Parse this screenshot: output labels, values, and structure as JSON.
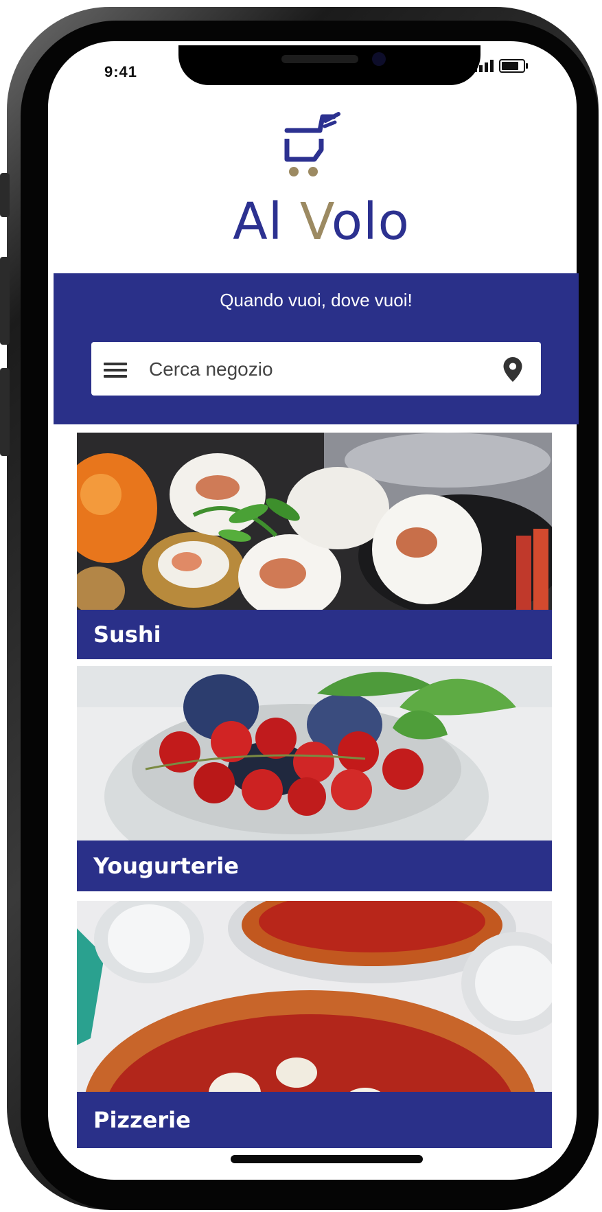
{
  "status_bar": {
    "time": "9:41"
  },
  "app": {
    "name_part1": "Al ",
    "name_v": "V",
    "name_part2": "olo"
  },
  "banner": {
    "tagline": "Quando vuoi, dove vuoi!"
  },
  "search": {
    "placeholder": "Cerca negozio"
  },
  "categories": [
    {
      "label": "Sushi"
    },
    {
      "label": "Yougurterie"
    },
    {
      "label": "Pizzerie"
    }
  ],
  "colors": {
    "brand_blue": "#2a3089",
    "logo_gold": "#9c8a62",
    "icons": [
      "menu-icon",
      "location-pin-icon",
      "cart-logo-icon"
    ]
  }
}
